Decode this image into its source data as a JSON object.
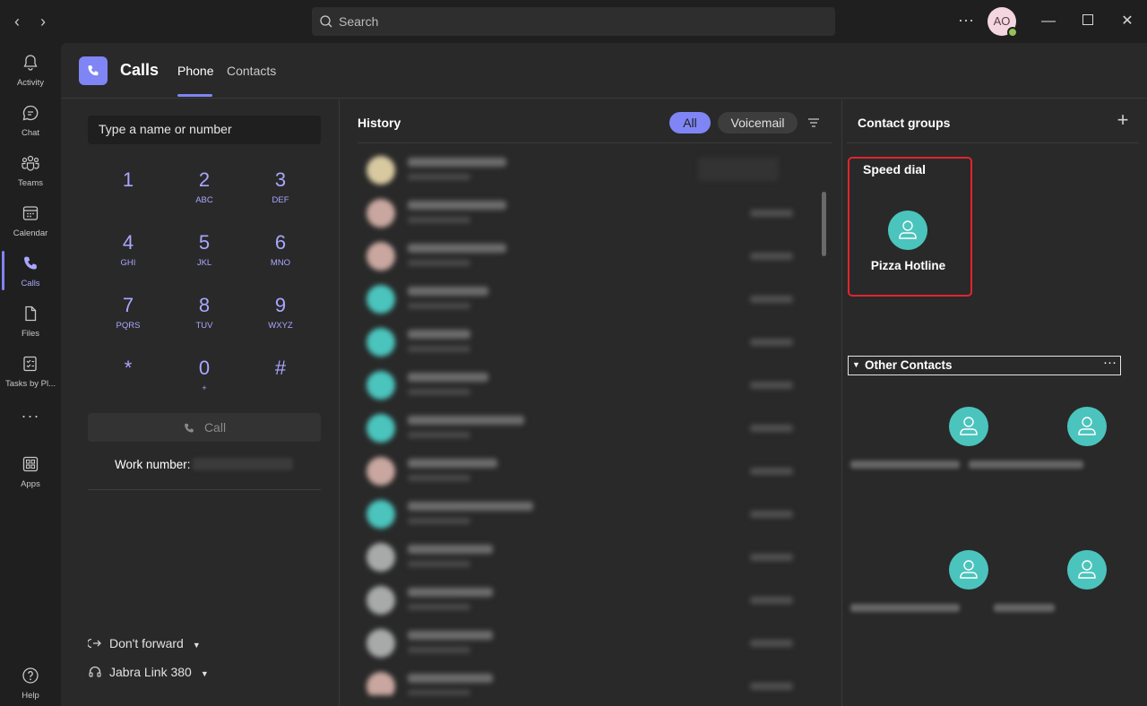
{
  "search": {
    "placeholder": "Search"
  },
  "user": {
    "initials": "AO"
  },
  "rail": [
    {
      "label": "Activity",
      "icon": "bell-icon"
    },
    {
      "label": "Chat",
      "icon": "chat-icon"
    },
    {
      "label": "Teams",
      "icon": "teams-icon"
    },
    {
      "label": "Calendar",
      "icon": "calendar-icon"
    },
    {
      "label": "Calls",
      "icon": "phone-icon",
      "active": true
    },
    {
      "label": "Files",
      "icon": "file-icon"
    },
    {
      "label": "Tasks by Pl...",
      "icon": "tasks-icon"
    },
    {
      "label": "Apps",
      "icon": "apps-icon"
    },
    {
      "label": "Help",
      "icon": "help-icon"
    }
  ],
  "app": {
    "title": "Calls",
    "tabs": [
      "Phone",
      "Contacts"
    ],
    "active_tab": "Phone"
  },
  "dialpad": {
    "input_placeholder": "Type a name or number",
    "keys": [
      {
        "digit": "1",
        "letters": ""
      },
      {
        "digit": "2",
        "letters": "ABC"
      },
      {
        "digit": "3",
        "letters": "DEF"
      },
      {
        "digit": "4",
        "letters": "GHI"
      },
      {
        "digit": "5",
        "letters": "JKL"
      },
      {
        "digit": "6",
        "letters": "MNO"
      },
      {
        "digit": "7",
        "letters": "PQRS"
      },
      {
        "digit": "8",
        "letters": "TUV"
      },
      {
        "digit": "9",
        "letters": "WXYZ"
      },
      {
        "digit": "*",
        "letters": ""
      },
      {
        "digit": "0",
        "letters": "+"
      },
      {
        "digit": "#",
        "letters": ""
      }
    ],
    "call_label": "Call",
    "work_number_label": "Work number:",
    "forward_label": "Don't forward",
    "device_label": "Jabra Link 380"
  },
  "history": {
    "title": "History",
    "filters": [
      "All",
      "Voicemail"
    ],
    "active_filter": "All"
  },
  "contact_groups": {
    "title": "Contact groups",
    "speed_dial": {
      "title": "Speed dial",
      "contacts": [
        "Pizza Hotline"
      ]
    },
    "other": {
      "title": "Other Contacts"
    }
  },
  "colors": {
    "accent": "#7f85f5",
    "contact_avatar": "#4bc4bd",
    "highlight": "#e0252c"
  }
}
